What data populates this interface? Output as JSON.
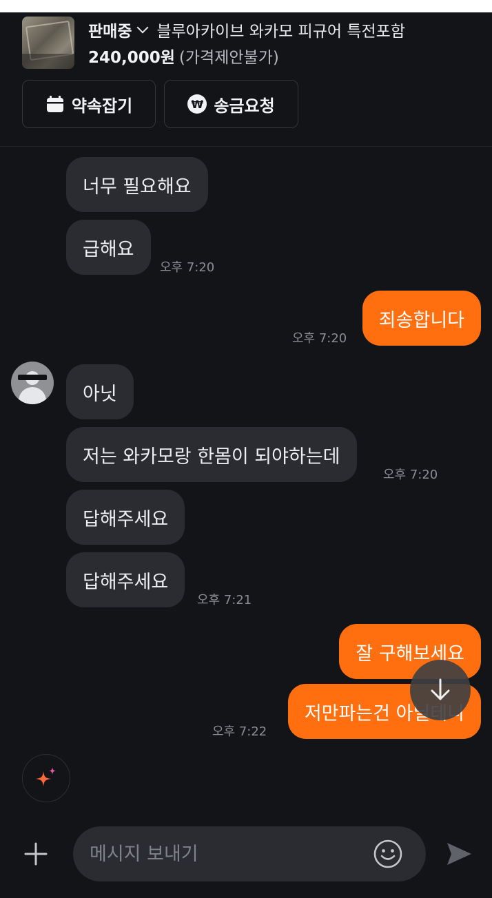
{
  "product": {
    "status": "판매중",
    "title": "블루아카이브 와카모 피규어 특전포함",
    "price": "240,000원",
    "price_note": "(가격제안불가)"
  },
  "actions": {
    "appointment_label": "약속잡기",
    "remit_label": "송금요청"
  },
  "messages": [
    {
      "text": "너무 필요해요",
      "time": ""
    },
    {
      "text": "급해요",
      "time": "오후 7:20"
    },
    {
      "text": "죄송합니다",
      "time": "오후 7:20"
    },
    {
      "text": "아닛",
      "time": ""
    },
    {
      "text": "저는 와카모랑 한몸이 되야하는데",
      "time": "오후 7:20"
    },
    {
      "text": "답해주세요",
      "time": ""
    },
    {
      "text": "답해주세요",
      "time": "오후 7:21"
    },
    {
      "text": "잘 구해보세요",
      "time": ""
    },
    {
      "text": "저만파는건 아닐테니",
      "time": "오후 7:22"
    }
  ],
  "composer": {
    "placeholder": "메시지 보내기"
  },
  "colors": {
    "background": "#131417",
    "incoming_bubble": "#2a2c31",
    "outgoing_bubble": "#ff6f0f"
  },
  "icons": [
    "calendar-icon",
    "won-icon",
    "chevron-down-icon",
    "arrow-down-icon",
    "sparkle-icon",
    "plus-icon",
    "smiley-icon",
    "send-icon"
  ]
}
